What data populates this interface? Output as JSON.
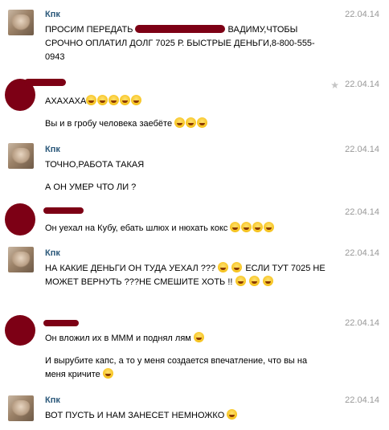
{
  "messages": [
    {
      "author": "Кпк",
      "date": "22.04.14",
      "lines": [
        "ПРОСИМ ПЕРЕДАТЬ",
        "ВАДИМУ,ЧТОБЫ СРОЧНО ОПЛАТИЛ ДОЛГ 7025 Р. БЫСТРЫЕ ДЕНЬГИ,8-800-555-0943"
      ]
    },
    {
      "author": "",
      "date": "22.04.14",
      "lines": [
        "АХАХАХА",
        "Вы и в гробу человека заебёте"
      ]
    },
    {
      "author": "Кпк",
      "date": "22.04.14",
      "lines": [
        "ТОЧНО,РАБОТА ТАКАЯ",
        "А ОН УМЕР ЧТО ЛИ ?"
      ]
    },
    {
      "author": "",
      "date": "22.04.14",
      "lines": [
        "Он уехал на Кубу, ебать шлюх и нюхать кокс"
      ]
    },
    {
      "author": "Кпк",
      "date": "22.04.14",
      "lines": [
        "НА КАКИЕ ДЕНЬГИ ОН ТУДА УЕХАЛ ???",
        "ЕСЛИ ТУТ 7025 НЕ МОЖЕТ ВЕРНУТЬ ???НЕ СМЕШИТЕ ХОТЬ !!"
      ]
    },
    {
      "author": "",
      "date": "22.04.14",
      "lines": [
        "Он вложил их в МММ и поднял лям",
        "И вырубите капс, а то у меня создается впечатление, что вы на меня кричите"
      ]
    },
    {
      "author": "Кпк",
      "date": "22.04.14",
      "lines": [
        "ВОТ ПУСТЬ И НАМ ЗАНЕСЕТ НЕМНОЖКО"
      ]
    }
  ],
  "icons": {
    "star": "star-icon",
    "smile": "smile-emoji",
    "shocked": "shocked-emoji",
    "tongue": "tongue-emoji"
  }
}
